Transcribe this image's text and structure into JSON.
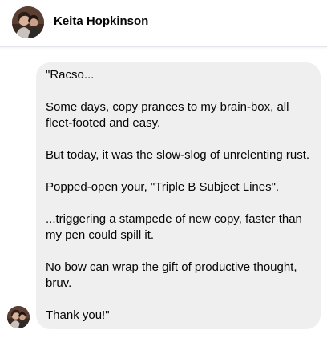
{
  "header": {
    "contact_name": "Keita Hopkinson",
    "avatar_icon": "profile-photo-icon"
  },
  "message": {
    "sender_avatar_icon": "profile-photo-icon",
    "bubble_color": "#efefef",
    "lines": [
      "\"Racso...",
      "Some days, copy prances to my brain-box, all",
      "fleet-footed and easy.",
      "But today, it was the slow-slog of unrelenting rust.",
      "Popped-open your, \"Triple B Subject Lines\".",
      "...triggering a stampede of new copy, faster than",
      "my pen could spill it.",
      "No bow can wrap the gift of productive thought,",
      "bruv.",
      "Thank you!\""
    ]
  }
}
